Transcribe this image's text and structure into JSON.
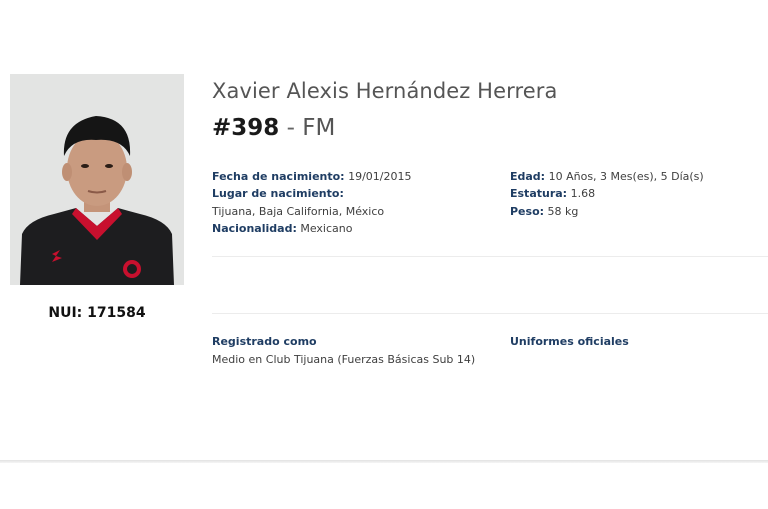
{
  "player": {
    "name": "Xavier Alexis Hernández Herrera",
    "number": "#398",
    "separator": "-",
    "position": "FM",
    "nui_label": "NUI:",
    "nui_value": "171584"
  },
  "details": {
    "birth_date_label": "Fecha de nacimiento:",
    "birth_date": "19/01/2015",
    "birth_place_label": "Lugar de nacimiento:",
    "birth_place": "Tijuana, Baja California, México",
    "nationality_label": "Nacionalidad:",
    "nationality": "Mexicano",
    "age_label": "Edad:",
    "age": "10 Años, 3 Mes(es), 5 Día(s)",
    "height_label": "Estatura:",
    "height": "1.68",
    "weight_label": "Peso:",
    "weight": "58 kg"
  },
  "registration": {
    "title": "Registrado como",
    "value": "Medio en Club Tijuana (Fuerzas Básicas Sub 14)"
  },
  "uniforms": {
    "title": "Uniformes oficiales"
  },
  "colors": {
    "label_blue": "#1f3d63",
    "jersey_black": "#1d1d1f",
    "jersey_red": "#c8102e"
  }
}
